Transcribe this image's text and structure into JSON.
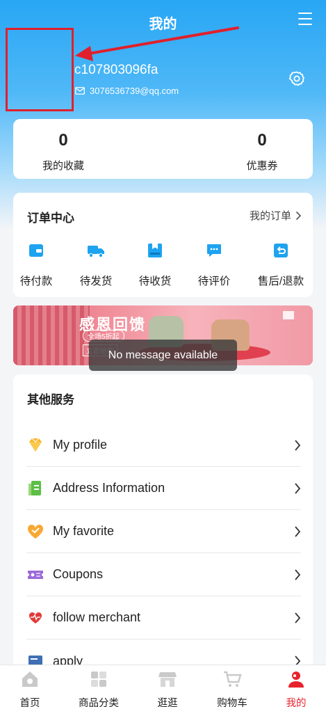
{
  "header": {
    "title": "我的"
  },
  "profile": {
    "username": "c107803096fa",
    "email": "3076536739@qq.com"
  },
  "stats": [
    {
      "value": "0",
      "label": "我的收藏"
    },
    {
      "value": "0",
      "label": "优惠券"
    }
  ],
  "orders": {
    "title": "订单中心",
    "more_label": "我的订单",
    "items": [
      {
        "label": "待付款",
        "icon": "wallet-icon"
      },
      {
        "label": "待发货",
        "icon": "truck-icon"
      },
      {
        "label": "待收货",
        "icon": "box-icon"
      },
      {
        "label": "待评价",
        "icon": "chat-icon"
      },
      {
        "label": "售后/退款",
        "icon": "refund-icon"
      }
    ]
  },
  "banner": {
    "title": "感恩回馈",
    "subtitle": "全场5折起",
    "button": "立即抢购"
  },
  "toast": {
    "message": "No message available"
  },
  "services": {
    "title": "其他服务",
    "items": [
      {
        "label": "My profile",
        "icon": "diamond-icon"
      },
      {
        "label": "Address Information",
        "icon": "address-book-icon"
      },
      {
        "label": "My favorite",
        "icon": "heart-icon"
      },
      {
        "label": "Coupons",
        "icon": "ticket-icon"
      },
      {
        "label": "follow merchant",
        "icon": "heart-monitor-icon"
      },
      {
        "label": "apply",
        "icon": "apply-icon"
      }
    ]
  },
  "tabbar": {
    "items": [
      {
        "label": "首页",
        "icon": "home-icon"
      },
      {
        "label": "商品分类",
        "icon": "category-icon"
      },
      {
        "label": "逛逛",
        "icon": "store-icon"
      },
      {
        "label": "购物车",
        "icon": "cart-icon"
      },
      {
        "label": "我的",
        "icon": "user-icon",
        "active": true
      }
    ],
    "active_color": "#e8222c"
  },
  "colors": {
    "accent": "#1ea3f0",
    "header_gradient_top": "#28a6f4",
    "annotation": "#e0202c"
  }
}
